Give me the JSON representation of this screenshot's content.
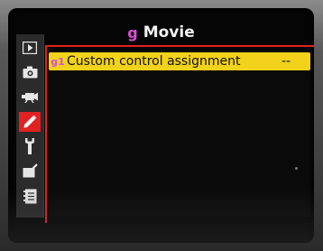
{
  "header": {
    "menu_glyph": "g",
    "title": "Movie"
  },
  "sidebar": {
    "items": [
      {
        "icon": "playback-icon",
        "active": false
      },
      {
        "icon": "camera-icon",
        "active": false
      },
      {
        "icon": "movie-camera-icon",
        "active": false
      },
      {
        "icon": "pencil-icon",
        "active": true
      },
      {
        "icon": "wrench-icon",
        "active": false
      },
      {
        "icon": "retouch-icon",
        "active": false
      },
      {
        "icon": "my-menu-icon",
        "active": false
      }
    ]
  },
  "menu": {
    "items": [
      {
        "code": "g1",
        "label": "Custom control assignment",
        "value": "--",
        "selected": true
      }
    ]
  },
  "colors": {
    "accent_red": "#e02222",
    "highlight_yellow": "#f2d21b",
    "glyph_magenta": "#d94fd9"
  }
}
